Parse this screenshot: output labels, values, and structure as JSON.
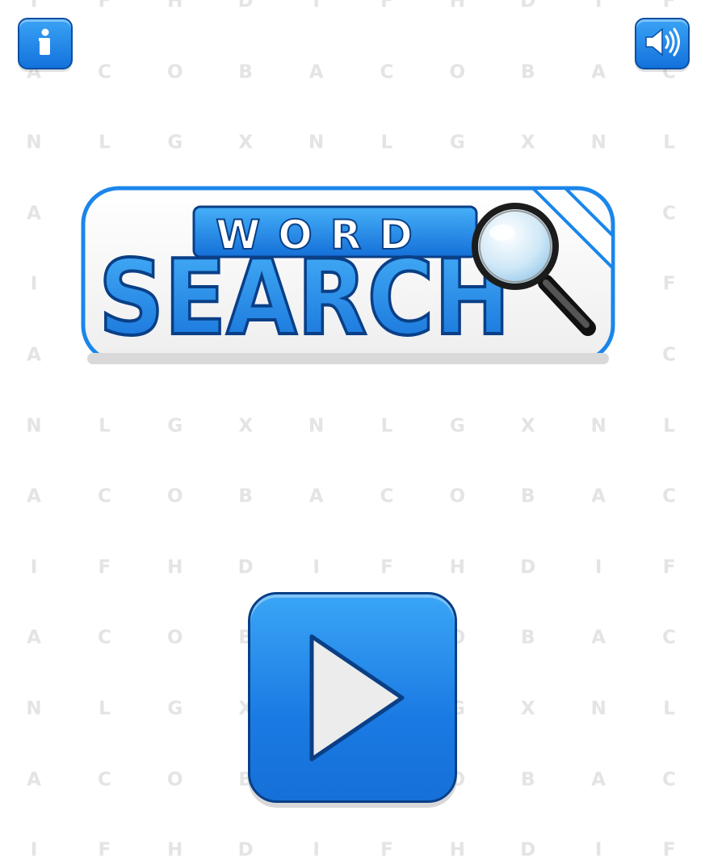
{
  "background_letter_rows": [
    "IFHDIFHDIF",
    "ACOBACOBAC",
    "NLGXNLGXNL",
    "ACOBACOBAC",
    "IFHDIFHDIF",
    "ACOBACOBAC",
    "NLGXNLGXNL",
    "ACOBACOBAC",
    "IFHDIFHDIF",
    "ACOBACOBAC",
    "NLGXNLGXNL",
    "ACOBACOBAC",
    "IFHDIFHDIF"
  ],
  "header": {
    "info_icon": "info-icon",
    "sound_icon": "speaker-icon"
  },
  "logo": {
    "line1": "WORD",
    "line2": "SEARCH",
    "icon": "magnifying-glass-icon"
  },
  "play": {
    "icon": "play-icon"
  },
  "colors": {
    "primary_blue": "#1a7ae3",
    "dark_blue": "#0a3f86",
    "light_blue": "#3aa6f6",
    "background_letters": "#e4e4e4"
  }
}
